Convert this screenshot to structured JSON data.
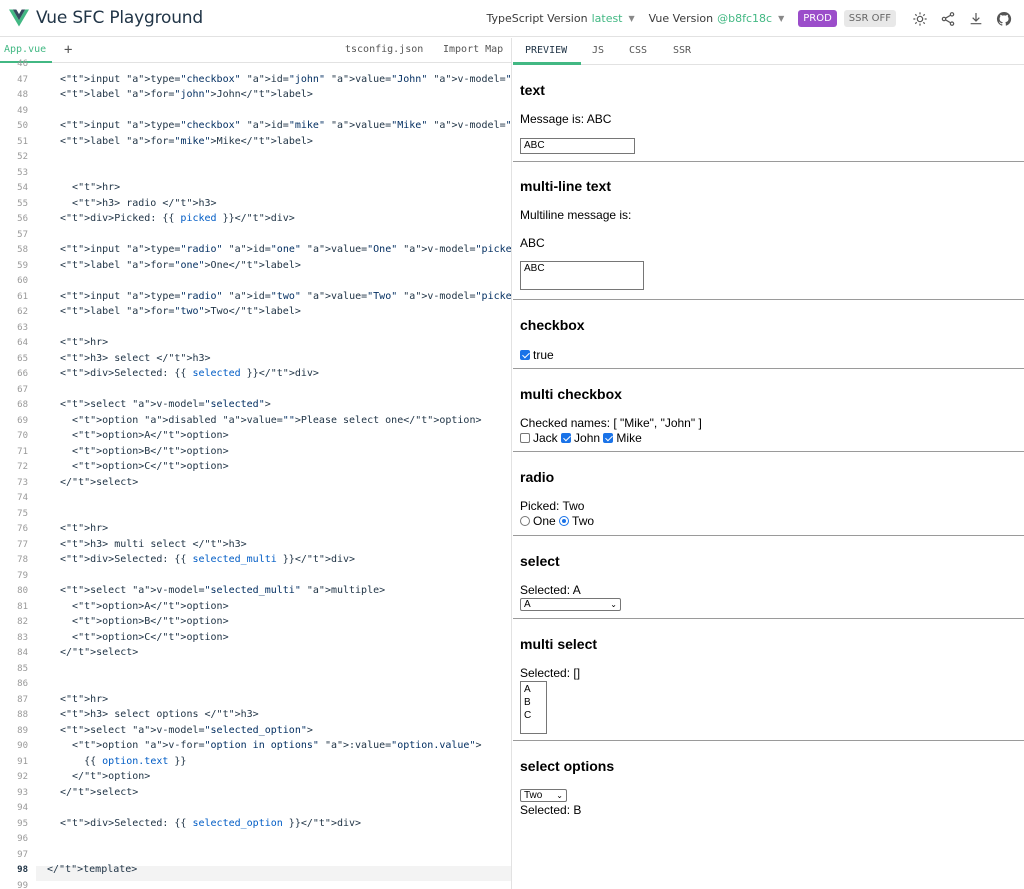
{
  "app": {
    "title": "Vue SFC Playground"
  },
  "nav": {
    "ts_label": "TypeScript Version",
    "ts_value": "latest",
    "vue_label": "Vue Version",
    "vue_value": "@b8fc18c",
    "prod": "PROD",
    "ssr": "SSR OFF"
  },
  "editor": {
    "active_file": "App.vue",
    "add": "+",
    "tsconfig": "tsconfig.json",
    "import_map": "Import Map"
  },
  "preview": {
    "tabs": [
      "PREVIEW",
      "JS",
      "CSS",
      "SSR"
    ],
    "text": {
      "heading": "text",
      "message": "Message is: ABC",
      "value": "ABC"
    },
    "multiline": {
      "heading": "multi-line text",
      "label": "Multiline message is:",
      "message": "ABC",
      "value": "ABC"
    },
    "checkbox": {
      "heading": "checkbox",
      "label": "true"
    },
    "multi_checkbox": {
      "heading": "multi checkbox",
      "summary": "Checked names: [ \"Mike\", \"John\" ]",
      "jack": "Jack",
      "john": "John",
      "mike": "Mike"
    },
    "radio": {
      "heading": "radio",
      "picked": "Picked: Two",
      "one": "One",
      "two": "Two"
    },
    "select": {
      "heading": "select",
      "selected": "Selected: A",
      "value": "A"
    },
    "multi_select": {
      "heading": "multi select",
      "selected": "Selected: []",
      "options": [
        "A",
        "B",
        "C"
      ]
    },
    "select_options": {
      "heading": "select options",
      "value": "Two",
      "selected": "Selected: B"
    }
  }
}
